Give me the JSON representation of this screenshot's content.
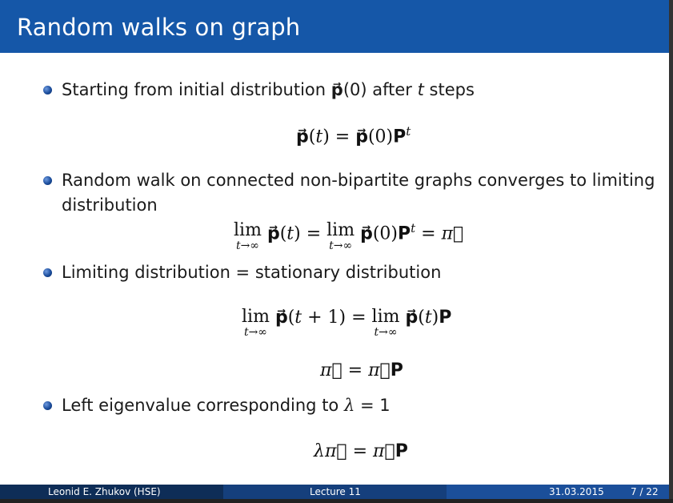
{
  "slide": {
    "title": "Random walks on graph",
    "bullets": [
      "Starting from initial distribution p⃗(0) after t steps",
      "Random walk on connected non-bipartite graphs converges to limiting distribution",
      "Limiting distribution = stationary distribution",
      "Left eigenvalue corresponding to λ = 1"
    ],
    "formulas": [
      "p⃗(t) = p⃗(0)P^t",
      "lim_{t→∞} p⃗(t) = lim_{t→∞} p⃗(0)P^t = π⃗",
      "lim_{t→∞} p⃗(t+1) = lim_{t→∞} p⃗(t)P",
      "π⃗ = π⃗P",
      "λπ⃗ = π⃗P"
    ]
  },
  "footer": {
    "author": "Leonid E. Zhukov  (HSE)",
    "lecture": "Lecture 11",
    "date": "31.03.2015",
    "page": "7 / 22"
  },
  "colors": {
    "header": "#1557a8",
    "footer_left": "#0e2d57",
    "footer_mid": "#153f7c",
    "footer_right": "#1b4f9a"
  }
}
